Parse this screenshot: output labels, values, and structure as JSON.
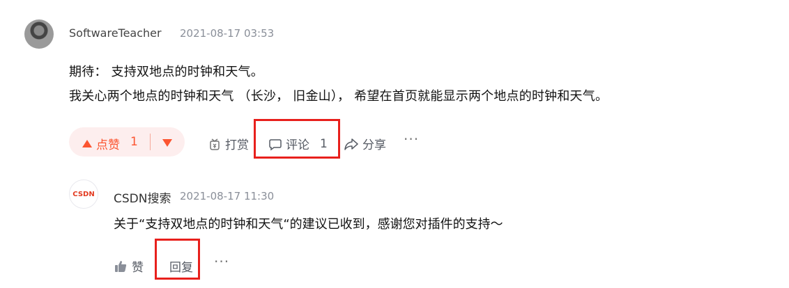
{
  "comment": {
    "username": "SoftwareTeacher",
    "timestamp": "2021-08-17 03:53",
    "line1": "期待： 支持双地点的时钟和天气。",
    "line2": "我关心两个地点的时钟和天气 （长沙， 旧金山）， 希望在首页就能显示两个地点的时钟和天气。",
    "like_label": "点赞",
    "like_count": "1",
    "reward_label": "打赏",
    "comment_label": "评论",
    "comment_count": "1",
    "share_label": "分享",
    "more_label": "···"
  },
  "reply": {
    "avatar_text": "CSDN",
    "username": "CSDN搜索",
    "timestamp": "2021-08-17 11:30",
    "content": "关于“支持双地点的时钟和天气“的建议已收到，感谢您对插件的支持～",
    "like_label": "赞",
    "reply_label": "回复",
    "more_label": "···"
  },
  "colors": {
    "accent": "#fc5531",
    "highlight": "#e8201c",
    "vote_bg": "#fdeeee"
  }
}
